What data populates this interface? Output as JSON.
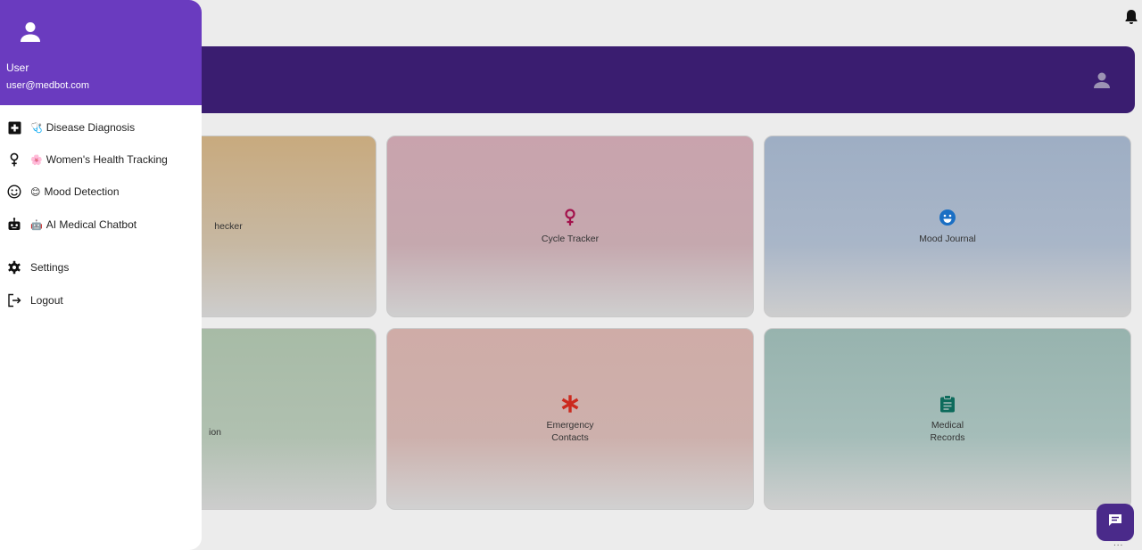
{
  "drawer": {
    "user_name": "User",
    "user_email": "user@medbot.com",
    "items": [
      {
        "icon": "medical-cross-icon",
        "emoji": "🩺",
        "label": "Disease Diagnosis"
      },
      {
        "icon": "female-icon",
        "emoji": "🌸",
        "label": "Women's Health Tracking"
      },
      {
        "icon": "smiley-icon",
        "emoji": "😊",
        "label": "Mood Detection"
      },
      {
        "icon": "robot-icon",
        "emoji": "🤖",
        "label": "AI Medical Chatbot"
      },
      {
        "icon": "gear-icon",
        "emoji": "",
        "label": "Settings"
      },
      {
        "icon": "logout-icon",
        "emoji": "",
        "label": "Logout"
      }
    ]
  },
  "cards": [
    {
      "label": "hecker"
    },
    {
      "label": "Cycle Tracker",
      "icon": "female-icon",
      "color": "#c2185b"
    },
    {
      "label": "Mood Journal",
      "icon": "smiley-icon",
      "color": "#1e88e5"
    },
    {
      "label": "ion"
    },
    {
      "label": "Emergency\nContacts",
      "icon": "asterisk-icon",
      "color": "#e53935"
    },
    {
      "label": "Medical\nRecords",
      "icon": "clipboard-icon",
      "color": "#00796b"
    }
  ],
  "colors": {
    "drawer_header": "#6a3bbf",
    "banner": "#3a1d70",
    "fab": "#4a2a8a"
  },
  "fab_dots": "..."
}
